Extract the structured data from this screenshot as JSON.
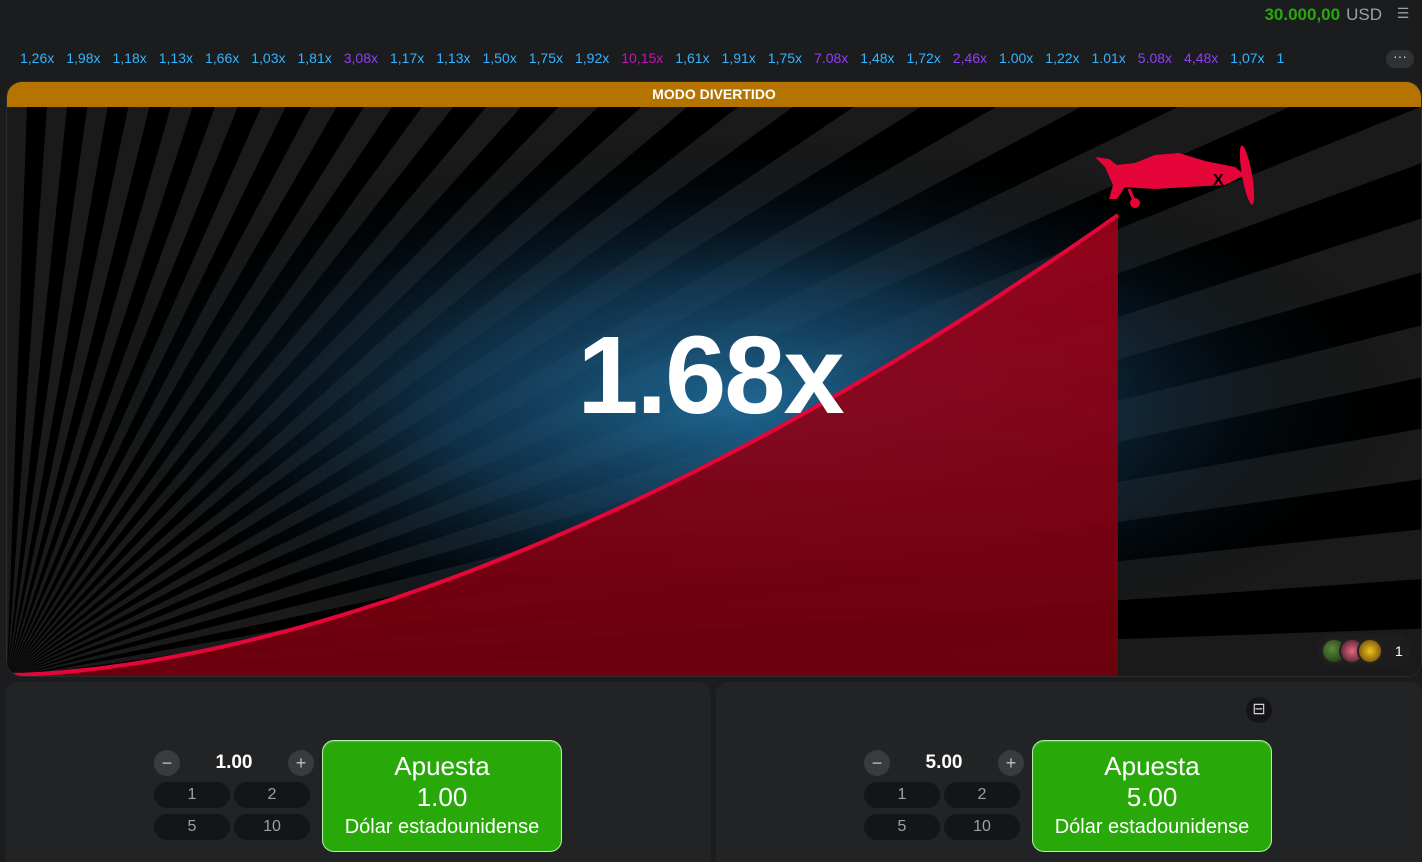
{
  "header": {
    "balance": "30.000,00",
    "currency": "USD",
    "menu_icon": "hamburger-menu-icon"
  },
  "history": {
    "items": [
      {
        "value": "1,26x",
        "color": "#34b4ff"
      },
      {
        "value": "1,98x",
        "color": "#34b4ff"
      },
      {
        "value": "1,18x",
        "color": "#34b4ff"
      },
      {
        "value": "1,13x",
        "color": "#34b4ff"
      },
      {
        "value": "1,66x",
        "color": "#34b4ff"
      },
      {
        "value": "1,03x",
        "color": "#34b4ff"
      },
      {
        "value": "1,81x",
        "color": "#34b4ff"
      },
      {
        "value": "3,08x",
        "color": "#913ef8"
      },
      {
        "value": "1,17x",
        "color": "#34b4ff"
      },
      {
        "value": "1,13x",
        "color": "#34b4ff"
      },
      {
        "value": "1,50x",
        "color": "#34b4ff"
      },
      {
        "value": "1,75x",
        "color": "#34b4ff"
      },
      {
        "value": "1,92x",
        "color": "#34b4ff"
      },
      {
        "value": "10,15x",
        "color": "#c017b4"
      },
      {
        "value": "1,61x",
        "color": "#34b4ff"
      },
      {
        "value": "1,91x",
        "color": "#34b4ff"
      },
      {
        "value": "1,75x",
        "color": "#34b4ff"
      },
      {
        "value": "7.08x",
        "color": "#913ef8"
      },
      {
        "value": "1,48x",
        "color": "#34b4ff"
      },
      {
        "value": "1,72x",
        "color": "#34b4ff"
      },
      {
        "value": "2,46x",
        "color": "#913ef8"
      },
      {
        "value": "1.00x",
        "color": "#34b4ff"
      },
      {
        "value": "1,22x",
        "color": "#34b4ff"
      },
      {
        "value": "1.01x",
        "color": "#34b4ff"
      },
      {
        "value": "5.08x",
        "color": "#913ef8"
      },
      {
        "value": "4,48x",
        "color": "#913ef8"
      },
      {
        "value": "1,07x",
        "color": "#34b4ff"
      },
      {
        "value": "1",
        "color": "#34b4ff"
      }
    ],
    "more_label": "···"
  },
  "game": {
    "mode_banner": "MODO DIVERTIDO",
    "multiplier": "1.68x",
    "players_count": "1",
    "plane_icon": "plane-icon",
    "colors": {
      "curve": "#e50539",
      "fill": "#8a0010",
      "glow": "#1d5f8c",
      "banner": "#b57400"
    }
  },
  "bets": [
    {
      "stake": "1.00",
      "quick": [
        "1",
        "2",
        "5",
        "10"
      ],
      "button_title": "Apuesta",
      "button_amount": "1.00",
      "button_currency": "Dólar estadounidense"
    },
    {
      "stake": "5.00",
      "quick": [
        "1",
        "2",
        "5",
        "10"
      ],
      "button_title": "Apuesta",
      "button_amount": "5.00",
      "button_currency": "Dólar estadounidense",
      "toggle_icon": "remove-bet-panel-icon"
    }
  ]
}
